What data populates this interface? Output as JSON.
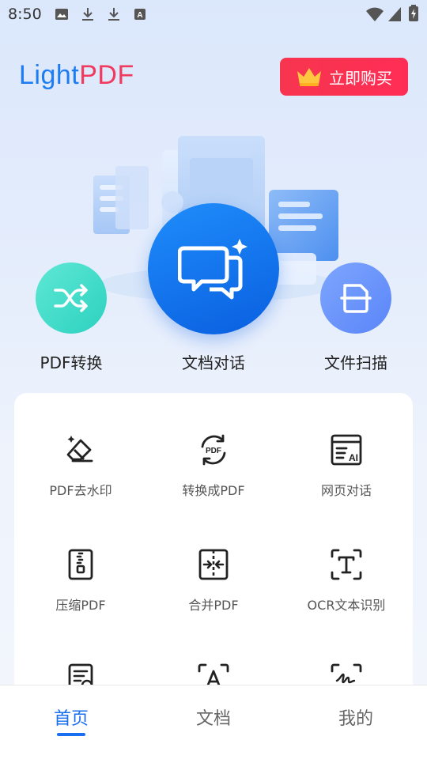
{
  "status_bar": {
    "time": "8:50",
    "icons_left": [
      "image-icon",
      "download-icon",
      "download-icon",
      "a-box-icon"
    ],
    "icons_right": [
      "wifi-icon",
      "signal-icon",
      "battery-icon"
    ]
  },
  "header": {
    "logo_light": "Light",
    "logo_pdf": "PDF",
    "buy_label": "立即购买",
    "buy_icon": "crown-icon"
  },
  "features": [
    {
      "label": "PDF转换",
      "icon": "shuffle-icon",
      "color": "#3dd9c6"
    },
    {
      "label": "文档对话",
      "icon": "chat-ai-icon",
      "color": "#1478f0"
    },
    {
      "label": "文件扫描",
      "icon": "scan-document-icon",
      "color": "#6b93fb"
    }
  ],
  "tools": [
    {
      "label": "PDF去水印",
      "icon": "eraser-icon"
    },
    {
      "label": "转换成PDF",
      "icon": "pdf-convert-icon"
    },
    {
      "label": "网页对话",
      "icon": "web-ai-icon"
    },
    {
      "label": "压缩PDF",
      "icon": "compress-icon"
    },
    {
      "label": "合并PDF",
      "icon": "merge-icon"
    },
    {
      "label": "OCR文本识别",
      "icon": "ocr-text-icon"
    },
    {
      "label": "",
      "icon": "document-check-icon"
    },
    {
      "label": "",
      "icon": "text-scan-icon"
    },
    {
      "label": "",
      "icon": "signature-icon"
    }
  ],
  "bottom_nav": {
    "items": [
      {
        "label": "首页",
        "active": true
      },
      {
        "label": "文档",
        "active": false
      },
      {
        "label": "我的",
        "active": false
      }
    ]
  },
  "colors": {
    "brand_blue": "#1d7cf2",
    "brand_red": "#f03a5f",
    "buy_red": "#f7354f",
    "active_tab": "#1a6ef0"
  }
}
